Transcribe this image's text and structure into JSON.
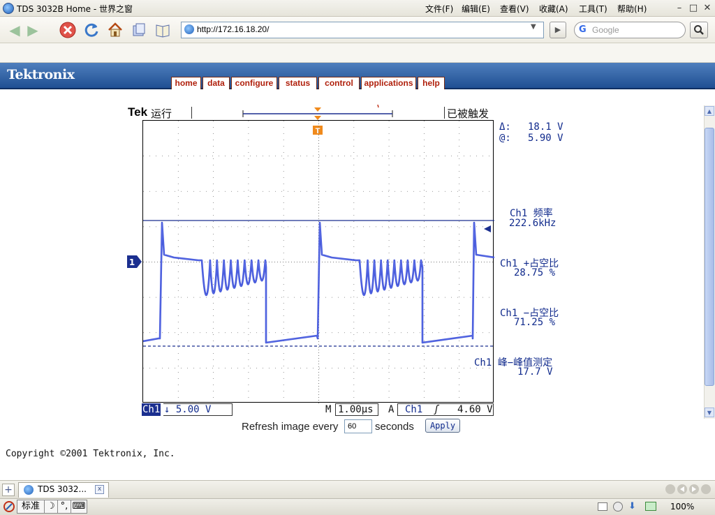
{
  "window": {
    "title": "TDS 3032B Home - 世界之窗",
    "menu": [
      "文件(F)",
      "编辑(E)",
      "查看(V)",
      "收藏(A)",
      "工具(T)",
      "帮助(H)"
    ],
    "controls": {
      "minimize": "–",
      "restore": "□",
      "close": "✕"
    }
  },
  "toolbar": {
    "url": "http://172.16.18.20/",
    "search_placeholder": "Google",
    "icons": [
      "back-icon",
      "forward-icon",
      "stop-icon",
      "refresh-icon",
      "home-icon",
      "history-icon",
      "favorites-icon"
    ]
  },
  "tek": {
    "logo": "Tektronix",
    "tabs": [
      "home",
      "data",
      "configure",
      "status",
      "control",
      "applications",
      "help"
    ]
  },
  "scope": {
    "brand": "Tek",
    "run_state": "运行",
    "trigger_state": "已被触发",
    "delta_label": "Δ:",
    "delta_value": "18.1 V",
    "at_label": "@:",
    "at_value": "5.90 V",
    "ch1_marker": "1",
    "trigger_marker": "T",
    "measurements": [
      {
        "label": "Ch1 频率",
        "value": "222.6kHz"
      },
      {
        "label": "Ch1 +占空比",
        "value": "28.75 %"
      },
      {
        "label": "Ch1 −占空比",
        "value": "71.25 %"
      },
      {
        "label": "Ch1 峰−峰值测定",
        "value": "17.7 V"
      }
    ],
    "readout": {
      "channel": "Ch1",
      "coupling_scale": "↓ 5.00 V",
      "time_prefix": "M",
      "time_scale": "1.00µs",
      "trigger_prefix": "A",
      "trigger_channel": "Ch1",
      "trigger_slope": "ʃ",
      "trigger_level": "4.60 V"
    },
    "colors": {
      "trace": "#2a3fd4",
      "text": "#102a8c",
      "cursor": "#1b2f8f",
      "trigger": "#f08a1c"
    }
  },
  "refresh": {
    "label": "Refresh image every",
    "value": "60",
    "unit": "seconds",
    "button": "Apply"
  },
  "copyright": "Copyright ©2001 Tektronix, Inc.",
  "tabbar": {
    "new_tab": "+",
    "tab_label": "TDS 3032...",
    "close": "x"
  },
  "statusbar": {
    "ime": [
      "标准",
      "☽",
      "°,",
      "⌨"
    ],
    "zoom": "100%"
  }
}
